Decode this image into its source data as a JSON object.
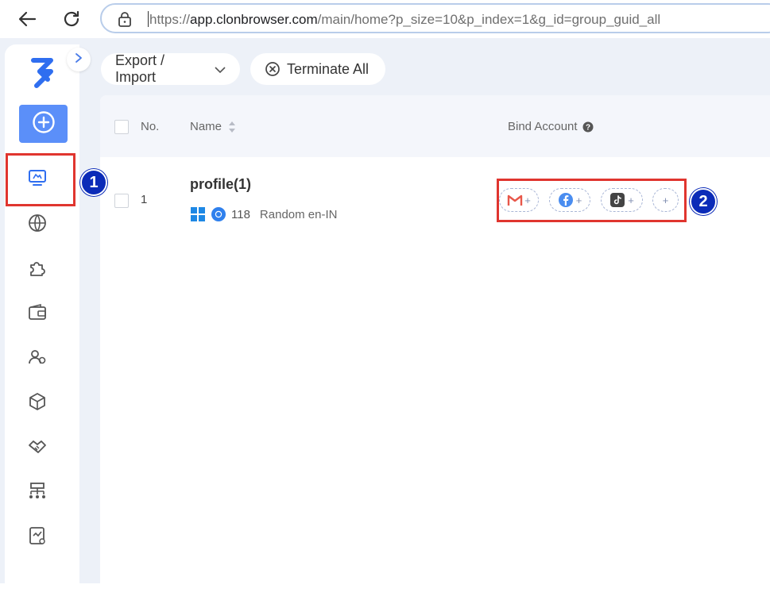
{
  "browser": {
    "url_prefix": "https://",
    "url_host": "app.clonbrowser.com",
    "url_rest": "/main/home?p_size=10&p_index=1&g_id=group_guid_all"
  },
  "toolbar": {
    "export_import_label": "Export / Import",
    "terminate_all_label": "Terminate All"
  },
  "table": {
    "headers": {
      "no": "No.",
      "name": "Name",
      "bind_account": "Bind Account"
    },
    "rows": [
      {
        "no": "1",
        "name": "profile(1)",
        "browser_version": "118",
        "fingerprint": "Random en-IN",
        "bind_chips": [
          "gmail-icon",
          "facebook-icon",
          "tiktok-icon",
          "add-icon"
        ]
      }
    ]
  },
  "sidebar": {
    "items": [
      "profiles-icon",
      "globe-icon",
      "extension-icon",
      "wallet-icon",
      "team-icon",
      "package-icon",
      "handshake-icon",
      "org-icon",
      "report-icon"
    ]
  },
  "annotations": {
    "marker_1": "1",
    "marker_2": "2",
    "marker_color": "#e0352f",
    "badge_color": "#0b2bb8"
  },
  "colors": {
    "accent": "#5b8ff9"
  }
}
